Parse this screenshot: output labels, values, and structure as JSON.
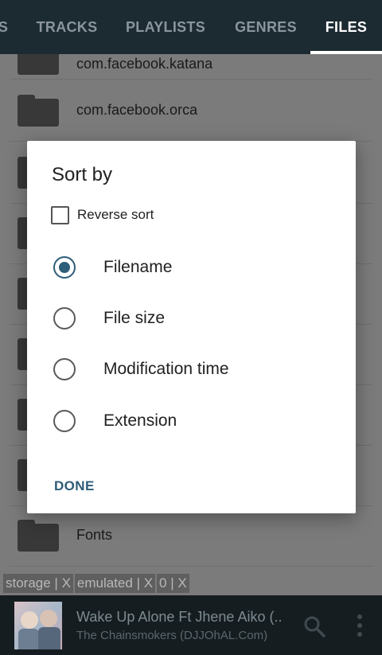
{
  "tabs": [
    {
      "label": "S"
    },
    {
      "label": "TRACKS"
    },
    {
      "label": "PLAYLISTS"
    },
    {
      "label": "GENRES"
    },
    {
      "label": "FILES",
      "active": true
    }
  ],
  "file_list": {
    "top_partial": "com.facebook.katana",
    "rows": [
      {
        "name": "com.facebook.orca"
      },
      {
        "name": ""
      },
      {
        "name": ""
      },
      {
        "name": ""
      },
      {
        "name": ""
      },
      {
        "name": ""
      },
      {
        "name": ""
      },
      {
        "name": "Fonts"
      }
    ]
  },
  "breadcrumb": [
    "storage | X",
    "emulated | X",
    "0 | X"
  ],
  "dialog": {
    "title": "Sort by",
    "reverse_sort": {
      "label": "Reverse sort",
      "checked": false
    },
    "options": [
      {
        "label": "Filename",
        "selected": true
      },
      {
        "label": "File size",
        "selected": false
      },
      {
        "label": "Modification time",
        "selected": false
      },
      {
        "label": "Extension",
        "selected": false
      }
    ],
    "done_label": "DONE"
  },
  "now_playing": {
    "title": "Wake Up Alone Ft Jhene Aiko (..",
    "artist": "The Chainsmokers (DJJOhAL.Com)"
  },
  "colors": {
    "accent": "#2e5d78",
    "tabbar": "#1c2a32",
    "nowplaying_bg": "#161d21"
  }
}
